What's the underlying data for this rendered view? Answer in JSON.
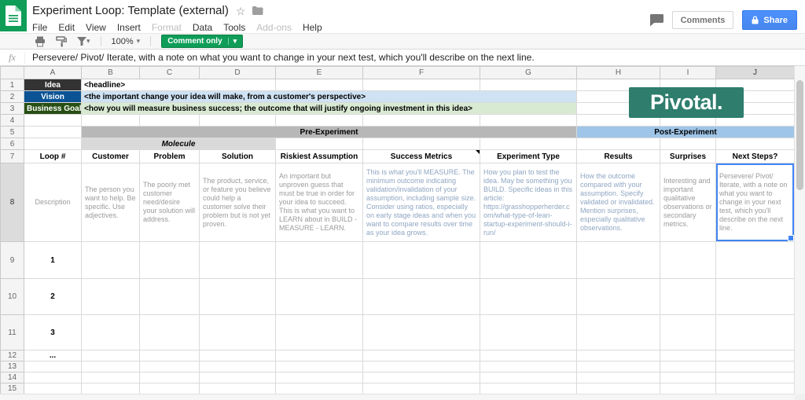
{
  "colors": {
    "sheets_green": "#0f9d58",
    "share_blue": "#4d90fe",
    "comment_green": "#0f9d58",
    "pivotal_teal": "#2e7d6d",
    "selection_blue": "#4285f4",
    "idea_dark": "#333333",
    "vision_blue": "#0b5394",
    "vision_light": "#cfe2f3",
    "goal_green": "#274e13",
    "goal_light": "#d9ead3",
    "pre_gray": "#b7b7b7",
    "post_blue": "#9fc5e8",
    "molecule_gray": "#d9d9d9"
  },
  "icons": {
    "star": "☆",
    "caret": "▾"
  },
  "header": {
    "title": "Experiment Loop: Template (external)",
    "menu": [
      "File",
      "Edit",
      "View",
      "Insert",
      "Format",
      "Data",
      "Tools",
      "Add-ons",
      "Help"
    ],
    "comments_button": "Comments",
    "share_button": "Share"
  },
  "toolbar": {
    "zoom": "100%",
    "mode": "Comment only"
  },
  "formula_bar": {
    "fx": "fx",
    "value": "Persevere/ Pivot/ Iterate, with a note on what you want to change in your next test, which you'll describe on the next line."
  },
  "grid": {
    "col_letters": [
      "A",
      "B",
      "C",
      "D",
      "E",
      "F",
      "G",
      "H",
      "I",
      "J"
    ],
    "row_numbers": [
      "1",
      "2",
      "3",
      "4",
      "5",
      "6",
      "7",
      "8",
      "9",
      "10",
      "11",
      "12",
      "13",
      "14",
      "15"
    ]
  },
  "cells": {
    "idea_label": "Idea",
    "idea_value": "<headline>",
    "vision_label": "Vision",
    "vision_value": "<the important change your idea will make, from a customer's perspective>",
    "goal_label": "Business Goal",
    "goal_value": "<how you will measure business success; the outcome that will justify ongoing investment in this idea>",
    "pre_experiment": "Pre-Experiment",
    "post_experiment": "Post-Experiment",
    "molecule": "Molecule",
    "headers": [
      "Loop #",
      "Customer",
      "Problem",
      "Solution",
      "Riskiest Assumption",
      "Success Metrics",
      "Experiment Type",
      "Results",
      "Surprises",
      "Next Steps?"
    ],
    "description": {
      "label": "Description",
      "customer": "The person you want to help. Be specific. Use adjectives.",
      "problem": "The poorly met customer need/desire your solution will address.",
      "solution": "The product, service, or feature you believe could help a customer solve their problem but is not yet proven.",
      "riskiest": "An important but unproven guess that must be true in order for your idea to succeed. This is what you want to LEARN about in BUILD - MEASURE - LEARN.",
      "metrics": "This is what you'll MEASURE. The minimum outcome indicating validation/invalidation of your assumption, including sample size. Consider using ratios, especially on early stage ideas and when you want to compare results over time as your idea grows.",
      "type": "How you plan to test the idea. May be something you BUILD. Specific ideas in this article: https://grasshopperherder.com/what-type-of-lean-startup-experiment-should-i-run/",
      "results": "How the outcome compared with your assumption. Specify validated or invalidated. Mention surprises, especially qualitative observations.",
      "surprises": "Interesting and important qualitative observations or secondary metrics.",
      "next_steps": "Persevere/ Pivot/ Iterate, with a note on what you want to change in your next test, which you'll describe on the next line."
    },
    "loops": [
      "1",
      "2",
      "3",
      "..."
    ]
  },
  "logo": {
    "text": "Pivotal."
  }
}
